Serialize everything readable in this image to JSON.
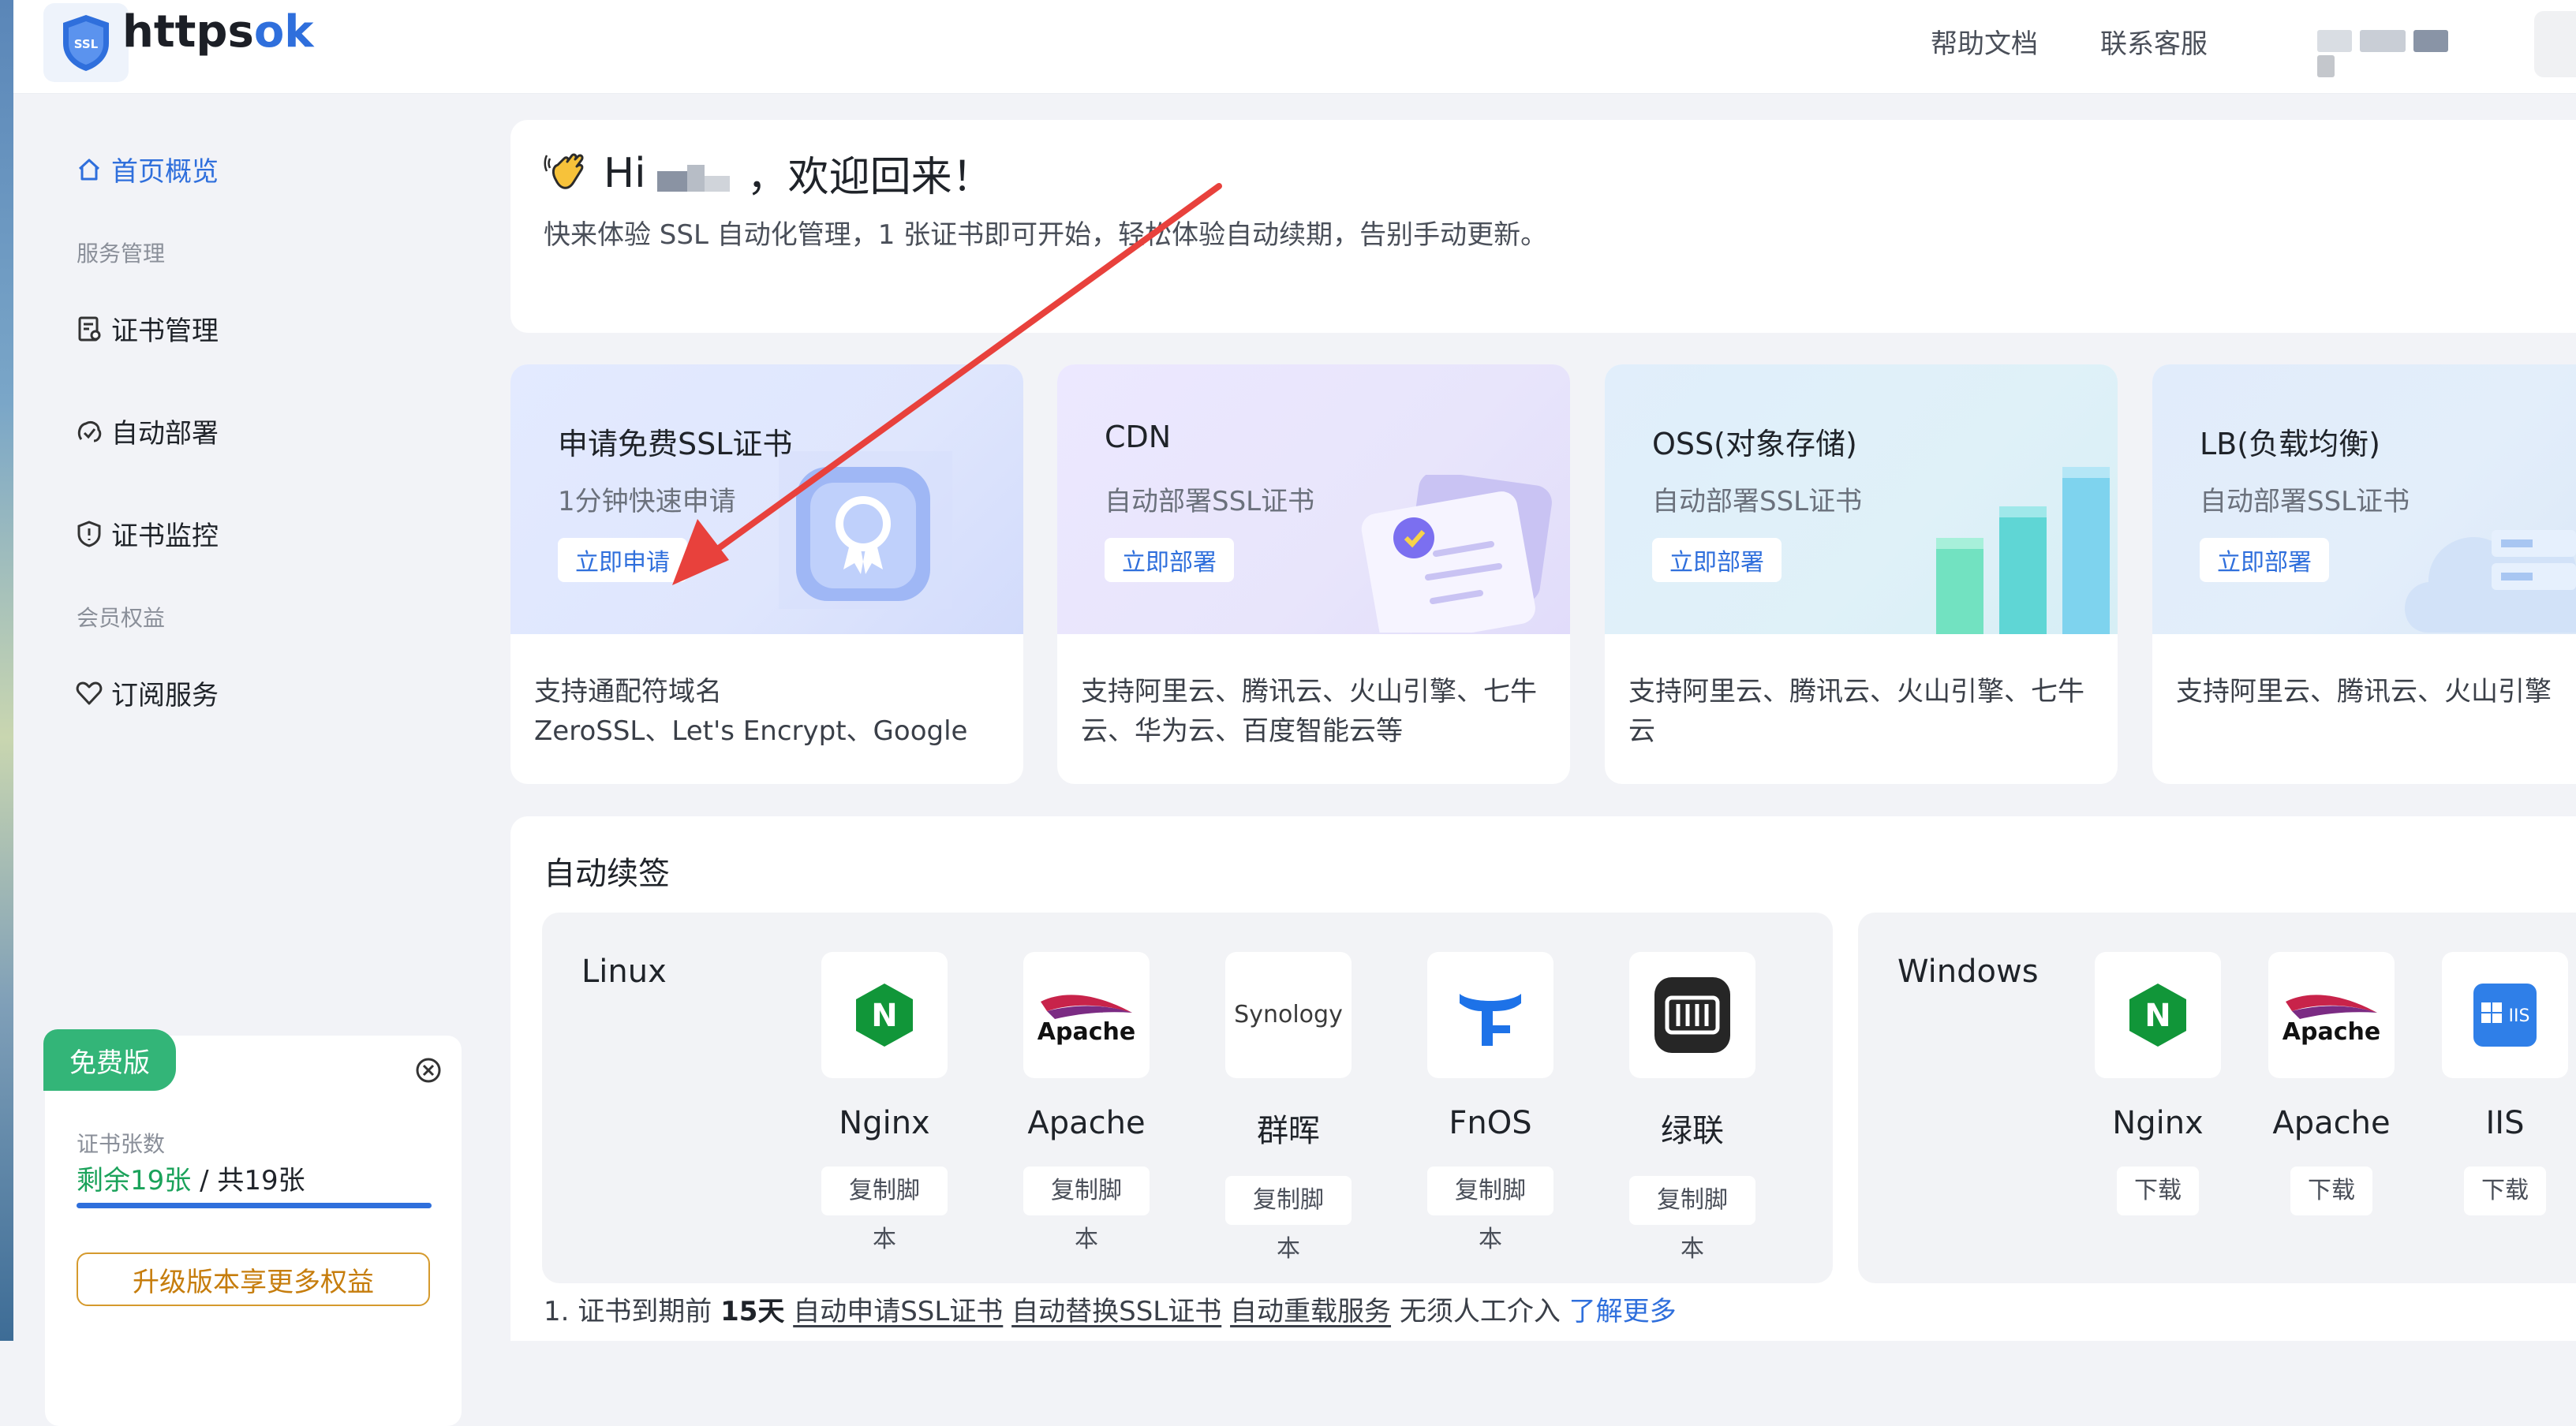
{
  "header": {
    "brand_prefix": "httpsok",
    "brand_main": "https",
    "brand_accent": "ok",
    "logo_text": "SSL",
    "links": [
      "帮助文档",
      "联系客服"
    ]
  },
  "sidebar": {
    "items": [
      {
        "label": "首页概览",
        "icon": "home-icon",
        "active": true
      },
      {
        "group": "服务管理"
      },
      {
        "label": "证书管理",
        "icon": "certificate-icon"
      },
      {
        "label": "自动部署",
        "icon": "deploy-icon"
      },
      {
        "label": "证书监控",
        "icon": "shield-icon"
      },
      {
        "group": "会员权益"
      },
      {
        "label": "订阅服务",
        "icon": "heart-icon"
      }
    ],
    "home": "首页概览",
    "group_service": "服务管理",
    "cert_mgmt": "证书管理",
    "auto_deploy": "自动部署",
    "cert_monitor": "证书监控",
    "group_member": "会员权益",
    "subscribe": "订阅服务"
  },
  "plan": {
    "badge": "免费版",
    "count_label": "证书张数",
    "remaining": "剩余19张",
    "total": " / 共19张",
    "usage_fraction": 1.0,
    "upgrade_button": "升级版本享更多权益"
  },
  "welcome": {
    "hi": "Hi",
    "greeting": "，欢迎回来！",
    "subtitle": "快来体验 SSL 自动化管理，1 张证书即可开始，轻松体验自动续期，告别手动更新。"
  },
  "features": [
    {
      "title": "申请免费SSL证书",
      "subtitle": "1分钟快速申请",
      "button": "立即申请",
      "desc": "支持通配符域名\nZeroSSL、Let's Encrypt、Google"
    },
    {
      "title": "CDN",
      "subtitle": "自动部署SSL证书",
      "button": "立即部署",
      "desc": "支持阿里云、腾讯云、火山引擎、七牛云、华为云、百度智能云等"
    },
    {
      "title": "OSS(对象存储)",
      "subtitle": "自动部署SSL证书",
      "button": "立即部署",
      "desc": "支持阿里云、腾讯云、火山引擎、七牛云"
    },
    {
      "title": "LB(负载均衡)",
      "subtitle": "自动部署SSL证书",
      "button": "立即部署",
      "desc": "支持阿里云、腾讯云、火山引擎"
    }
  ],
  "renew": {
    "title": "自动续签",
    "linux": {
      "name": "Linux",
      "tools": [
        {
          "name": "Nginx",
          "button": "复制脚本",
          "icon": "nginx-icon"
        },
        {
          "name": "Apache",
          "button": "复制脚本",
          "icon": "apache-icon"
        },
        {
          "name": "群晖",
          "button": "复制脚本",
          "icon": "synology-icon"
        },
        {
          "name": "FnOS",
          "button": "复制脚本",
          "icon": "fnos-icon"
        },
        {
          "name": "绿联",
          "button": "复制脚本",
          "icon": "ugreen-icon"
        }
      ]
    },
    "windows": {
      "name": "Windows",
      "tools": [
        {
          "name": "Nginx",
          "button": "下载",
          "icon": "nginx-icon"
        },
        {
          "name": "Apache",
          "button": "下载",
          "icon": "apache-icon"
        },
        {
          "name": "IIS",
          "button": "下载",
          "icon": "iis-icon"
        }
      ]
    },
    "note_prefix": "1. 证书到期前 ",
    "note_days": "15天",
    "note_link1": "自动申请SSL证书",
    "note_link2": "自动替换SSL证书",
    "note_link3": "自动重载服务",
    "note_tail": " 无须人工介入 ",
    "note_more": "了解更多"
  },
  "logo_labels": {
    "apache": "Apache",
    "synology": "Synology",
    "iis": "IIS",
    "nginx_letter": "N"
  },
  "colors": {
    "accent": "#2f6fdc",
    "free_badge": "#33b578",
    "remaining_green": "#1aa25a",
    "upgrade_orange": "#c67d0d",
    "annotation_arrow": "#e8413c"
  }
}
